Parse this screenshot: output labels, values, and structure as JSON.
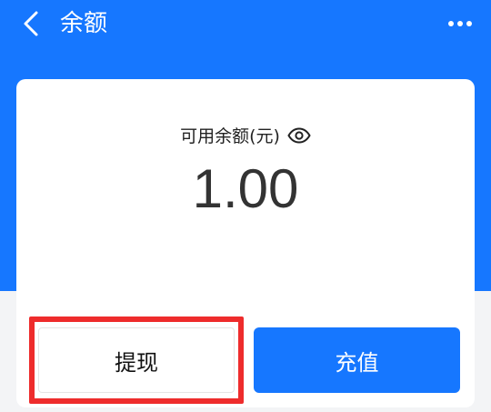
{
  "header": {
    "title": "余额",
    "back_icon": "chevron-left-icon",
    "more_icon": "more-dots-icon"
  },
  "balance": {
    "label": "可用余额(元)",
    "visibility_icon": "eye-icon",
    "amount": "1.00"
  },
  "actions": {
    "withdraw_label": "提现",
    "recharge_label": "充值"
  },
  "colors": {
    "primary": "#1677ff",
    "highlight": "#ee2c2c",
    "card": "#ffffff"
  }
}
